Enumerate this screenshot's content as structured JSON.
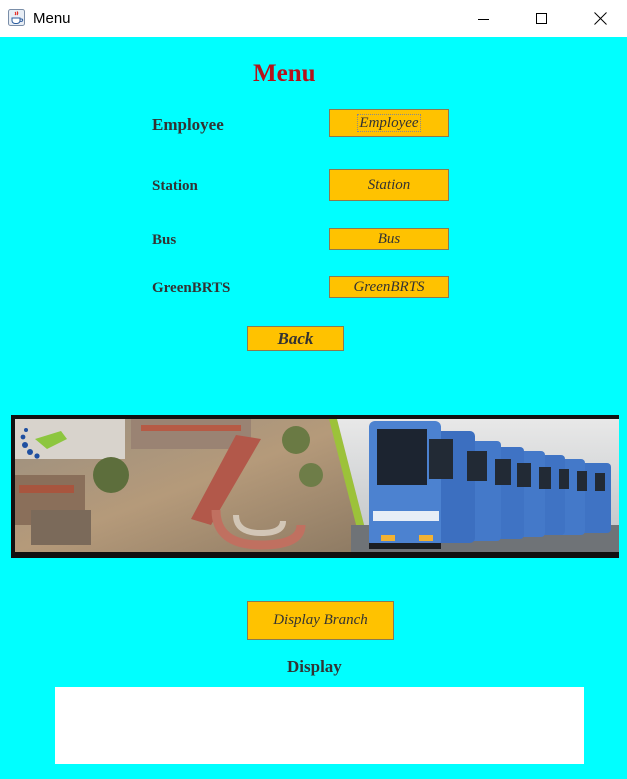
{
  "window": {
    "title": "Menu",
    "icon": "java-cup-icon"
  },
  "heading": "Menu",
  "menu": {
    "employee": {
      "label": "Employee",
      "button": "Employee"
    },
    "station": {
      "label": "Station",
      "button": "Station"
    },
    "bus": {
      "label": "Bus",
      "button": "Bus"
    },
    "green_brts": {
      "label": "GreenBRTS",
      "button": "GreenBRTS"
    }
  },
  "back_button": "Back",
  "display_branch_button": "Display Branch",
  "display_label": "Display",
  "display_value": "",
  "colors": {
    "background": "#00ffff",
    "button": "#ffc200",
    "heading": "#b5121b",
    "label": "#333333"
  }
}
